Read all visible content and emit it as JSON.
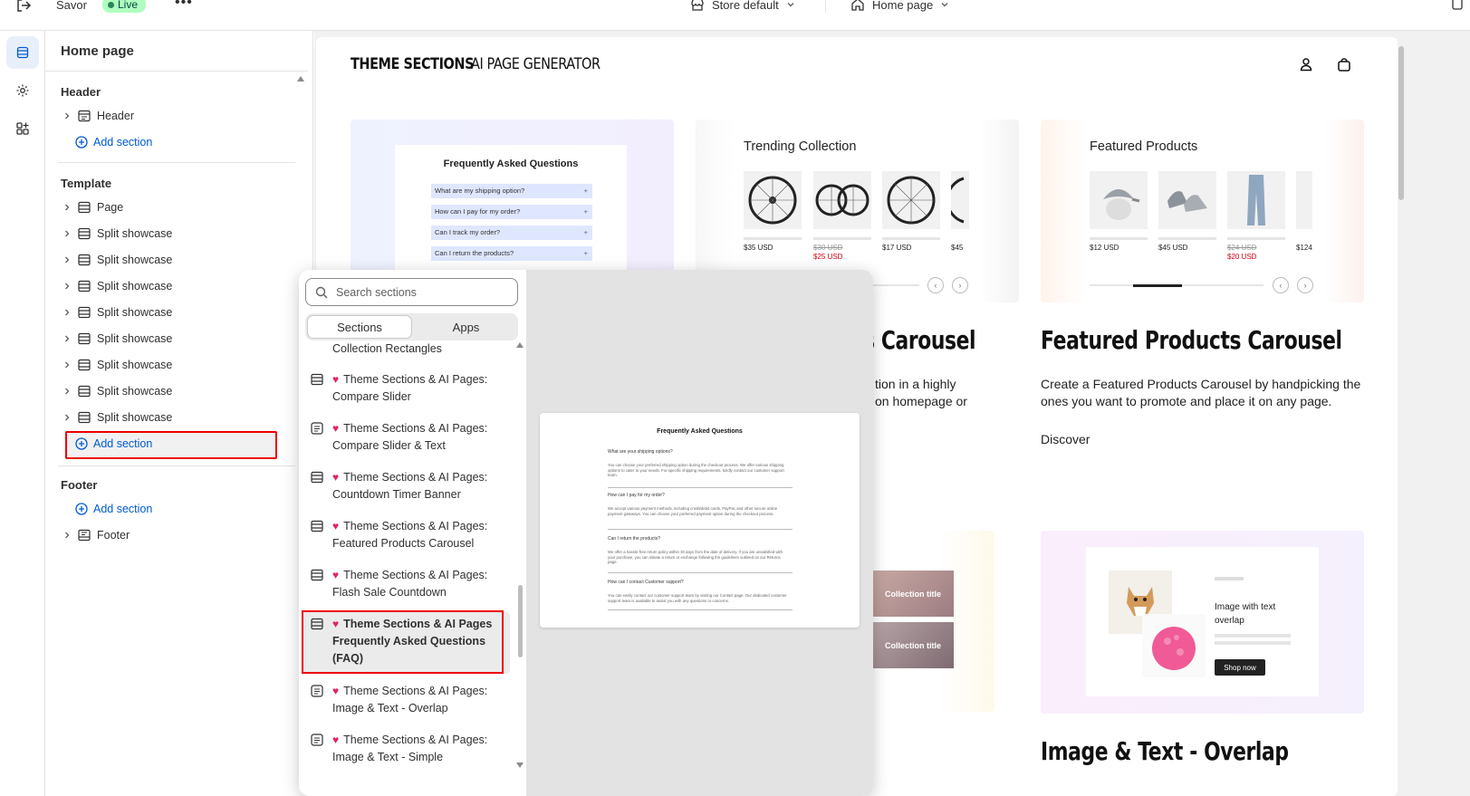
{
  "topbar": {
    "theme_name": "Savor",
    "status": "Live",
    "more": "•••",
    "store": "Store default",
    "page": "Home page"
  },
  "sidebar": {
    "title": "Home page",
    "header_group": "Header",
    "header_item": "Header",
    "add_section": "Add section",
    "template_group": "Template",
    "template_items": [
      "Page",
      "Split showcase",
      "Split showcase",
      "Split showcase",
      "Split showcase",
      "Split showcase",
      "Split showcase",
      "Split showcase",
      "Split showcase"
    ],
    "footer_group": "Footer",
    "footer_item": "Footer"
  },
  "preview": {
    "brand_primary": "THEME SECTIONS",
    "brand_secondary": "AI PAGE GENERATOR",
    "faq_card": {
      "title": "Frequently Asked Questions",
      "questions": [
        "What are my shipping option?",
        "How can I pay for my order?",
        "Can I track my order?",
        "Can I return the products?"
      ]
    },
    "trending": {
      "title": "Trending Collection",
      "prices": [
        "$35 USD",
        "$30 USD",
        "$25 USD",
        "$17 USD",
        "$45"
      ]
    },
    "featured": {
      "title": "Featured Products",
      "prices": [
        "$12 USD",
        "$45 USD",
        "$24 USD",
        "$20 USD",
        "$124"
      ]
    },
    "carousel_partial_heading": "ts Carousel",
    "carousel_partial_lines": [
      "tion in a highly",
      "on homepage or"
    ],
    "featured_heading": "Featured Products Carousel",
    "featured_desc": "Create a Featured Products Carousel by handpicking the ones you want to promote and place it on any page.",
    "discover": "Discover",
    "collection_title": "Collection title",
    "image_text_card": {
      "text": "Image with text overlap",
      "button": "Shop now"
    },
    "partial_s": "s",
    "image_text_heading": "Image & Text - Overlap"
  },
  "popover": {
    "search_placeholder": "Search sections",
    "tabs": [
      "Sections",
      "Apps"
    ],
    "partial_item": "Collection Rectangles",
    "items": [
      {
        "title": "Theme Sections & AI Pages:",
        "sub": "Compare Slider"
      },
      {
        "title": "Theme Sections & AI Pages:",
        "sub": "Compare Slider & Text"
      },
      {
        "title": "Theme Sections & AI Pages:",
        "sub": "Countdown Timer Banner"
      },
      {
        "title": "Theme Sections & AI Pages:",
        "sub": "Featured Products Carousel"
      },
      {
        "title": "Theme Sections & AI Pages:",
        "sub": "Flash Sale Countdown"
      },
      {
        "title": "Theme Sections & AI Pages",
        "sub": "Frequently Asked Questions (FAQ)"
      },
      {
        "title": "Theme Sections & AI Pages:",
        "sub": "Image & Text - Overlap"
      },
      {
        "title": "Theme Sections & AI Pages:",
        "sub": "Image & Text - Simple"
      }
    ],
    "preview_faq": {
      "title": "Frequently Asked Questions",
      "qa": [
        {
          "q": "What are your shipping options?",
          "a": "You can choose your preferred shipping option during the checkout process. We offer various shipping options to cater to your needs. For specific shipping requirements, kindly contact our customer support team."
        },
        {
          "q": "How can I pay for my order?",
          "a": "We accept various payment methods, including credit/debit cards, PayPal, and other secure online payment gateways. You can choose your preferred payment option during the checkout process."
        },
        {
          "q": "Can I return the products?",
          "a": "We offer a hassle-free return policy within 30 days from the date of delivery. If you are unsatisfied with your purchase, you can initiate a return or exchange following the guidelines outlined on our Returns page."
        },
        {
          "q": "How can I contact Customer support?",
          "a": "You can easily contact our customer support team by visiting our Contact page. Our dedicated customer support team is available to assist you with any questions or concerns."
        }
      ]
    }
  },
  "colors": {
    "accent": "#005bd3",
    "highlight": "#ee0000",
    "live_bg": "#affebf",
    "heart": "#e0245e"
  }
}
